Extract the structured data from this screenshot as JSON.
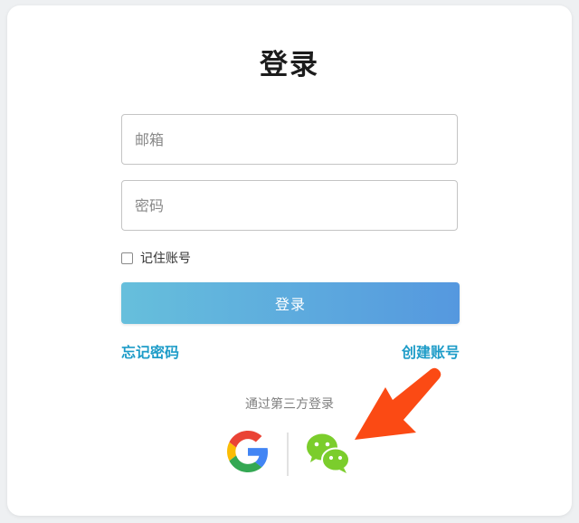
{
  "login": {
    "title": "登录",
    "email_placeholder": "邮箱",
    "password_placeholder": "密码",
    "remember_label": "记住账号",
    "submit_label": "登录",
    "forgot_label": "忘记密码",
    "create_label": "创建账号",
    "third_party_label": "通过第三方登录"
  },
  "social": {
    "google_icon": "google-g-logo",
    "wechat_icon": "wechat-logo"
  },
  "colors": {
    "link": "#1e9cc8",
    "button_gradient_start": "#66bfdc",
    "button_gradient_end": "#5598df",
    "wechat_green": "#7bcd2c",
    "annotation_arrow": "#fb4a14"
  }
}
